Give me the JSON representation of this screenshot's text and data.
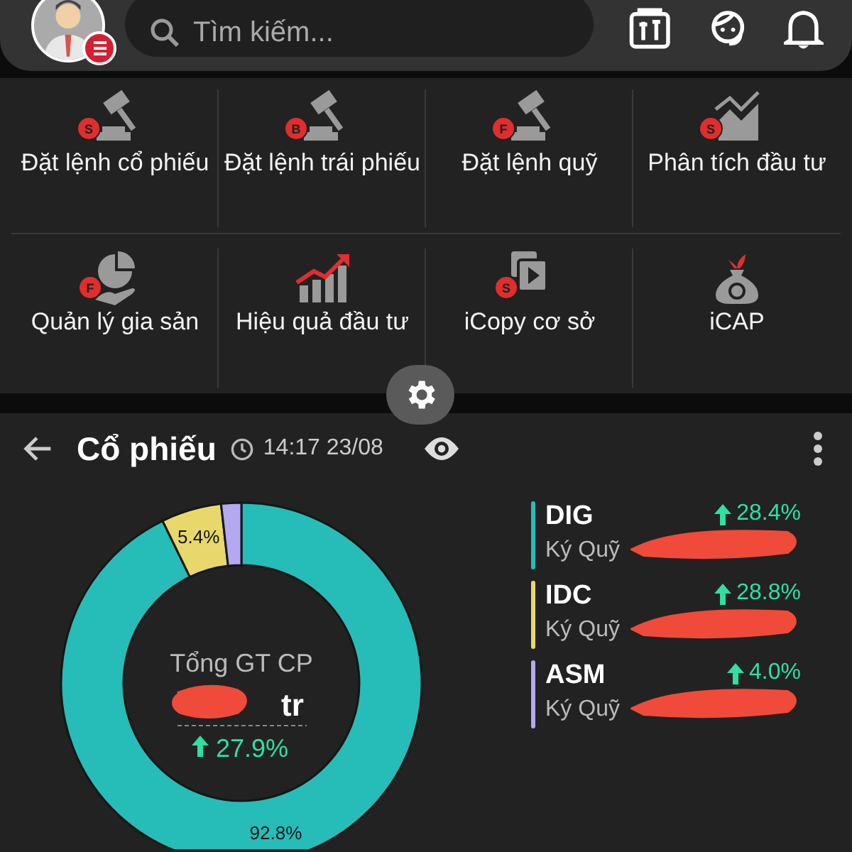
{
  "top_bar": {
    "search": {
      "placeholder": "Tìm kiếm..."
    }
  },
  "menu": [
    {
      "label": "Đặt lệnh cổ phiếu",
      "badge": "S",
      "kind": "gavel"
    },
    {
      "label": "Đặt lệnh trái phiếu",
      "badge": "B",
      "kind": "gavel"
    },
    {
      "label": "Đặt lệnh quỹ",
      "badge": "F",
      "kind": "gavel"
    },
    {
      "label": "Phân tích đầu tư",
      "badge": "S",
      "kind": "analytics"
    },
    {
      "label": "Quản lý gia sản",
      "badge": "F",
      "kind": "pie-hand"
    },
    {
      "label": "Hiệu quả đầu tư",
      "kind": "growth"
    },
    {
      "label": "iCopy cơ sở",
      "badge": "S",
      "kind": "copy-play"
    },
    {
      "label": "iCAP",
      "kind": "money-bag"
    }
  ],
  "portfolio": {
    "title": "Cổ phiếu",
    "time": "14:17 23/08",
    "total": {
      "label": "Tổng GT CP",
      "value_redacted": true,
      "unit": "tr",
      "change": "27.9%"
    },
    "chart_data": {
      "type": "donut",
      "categories": [
        "DIG",
        "IDC",
        "ASM"
      ],
      "values": [
        92.8,
        5.4,
        1.8
      ],
      "colors": [
        "#26bdb8",
        "#e8d86c",
        "#b4a8f0"
      ],
      "value_labels": [
        "92.8%",
        "5.4%",
        null
      ]
    },
    "holdings": [
      {
        "account": "Ký Quỹ",
        "change": "28.4%",
        "value_redacted": true
      },
      {
        "account": "Ký Quỹ",
        "change": "28.8%",
        "value_redacted": true
      },
      {
        "account": "Ký Quỹ",
        "change": "4.0%",
        "value_redacted": true
      }
    ]
  }
}
